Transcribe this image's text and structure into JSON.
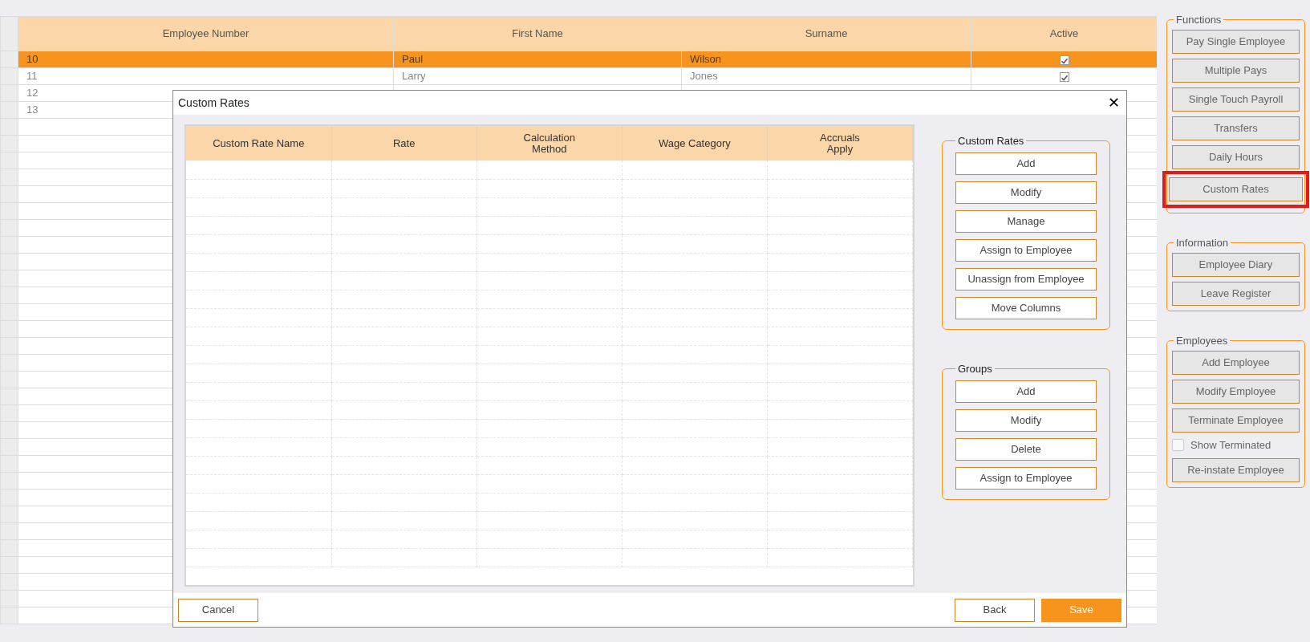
{
  "employee_grid": {
    "columns": [
      "Employee Number",
      "First Name",
      "Surname",
      "Active"
    ],
    "rows": [
      {
        "number": "10",
        "first_name": "Paul",
        "surname": "Wilson",
        "active": true,
        "selected": true
      },
      {
        "number": "11",
        "first_name": "Larry",
        "surname": "Jones",
        "active": true,
        "selected": false
      },
      {
        "number": "12",
        "selected": false
      },
      {
        "number": "13",
        "selected": false
      }
    ]
  },
  "side_panel": {
    "groups": [
      {
        "title": "Functions",
        "items": [
          {
            "kind": "button",
            "label": "Pay Single Employee",
            "highlighted": false
          },
          {
            "kind": "button",
            "label": "Multiple Pays",
            "highlighted": false
          },
          {
            "kind": "button",
            "label": "Single Touch Payroll",
            "highlighted": false
          },
          {
            "kind": "button",
            "label": "Transfers",
            "highlighted": false
          },
          {
            "kind": "button",
            "label": "Daily Hours",
            "highlighted": false
          },
          {
            "kind": "button",
            "label": "Custom Rates",
            "highlighted": true
          }
        ]
      },
      {
        "title": "Information",
        "items": [
          {
            "kind": "button",
            "label": "Employee Diary",
            "highlighted": false
          },
          {
            "kind": "button",
            "label": "Leave Register",
            "highlighted": false
          }
        ]
      },
      {
        "title": "Employees",
        "items": [
          {
            "kind": "button",
            "label": "Add Employee",
            "highlighted": false
          },
          {
            "kind": "button",
            "label": "Modify Employee",
            "highlighted": false
          },
          {
            "kind": "button",
            "label": "Terminate Employee",
            "highlighted": false
          },
          {
            "kind": "checkbox",
            "label": "Show Terminated",
            "checked": false
          },
          {
            "kind": "button",
            "label": "Re-instate Employee",
            "highlighted": false
          }
        ]
      }
    ]
  },
  "dialog": {
    "title": "Custom Rates",
    "close": "✕",
    "table": {
      "columns": [
        "Custom Rate Name",
        "Rate",
        "Calculation\nMethod",
        "Wage Category",
        "Accruals\nApply"
      ]
    },
    "groups": [
      {
        "title": "Custom Rates",
        "buttons": [
          "Add",
          "Modify",
          "Manage",
          "Assign to Employee",
          "Unassign from Employee",
          "Move Columns"
        ]
      },
      {
        "title": "Groups",
        "buttons": [
          "Add",
          "Modify",
          "Delete",
          "Assign to Employee"
        ]
      }
    ],
    "footer": [
      {
        "label": "Cancel",
        "kind": "secondary"
      },
      {
        "label": "Back",
        "kind": "secondary"
      },
      {
        "label": "Save",
        "kind": "primary"
      }
    ]
  }
}
